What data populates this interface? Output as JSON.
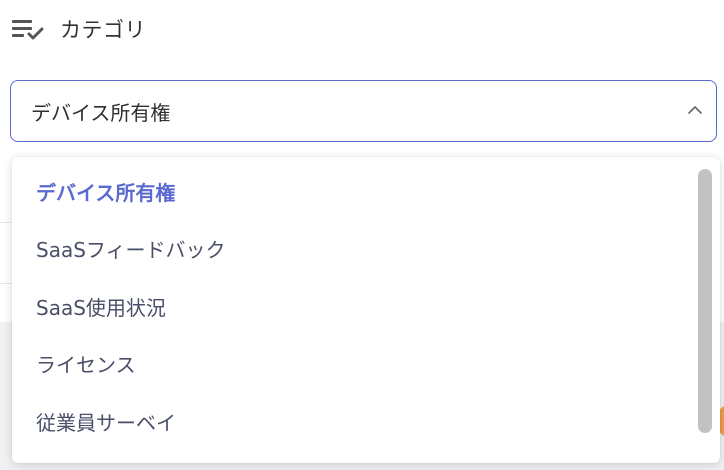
{
  "field": {
    "label": "カテゴリ",
    "label_icon": "list-check-icon"
  },
  "select": {
    "value": "デバイス所有権",
    "icon": "chevron-up-icon",
    "expanded": true
  },
  "dropdown": {
    "options": [
      {
        "label": "デバイス所有権",
        "selected": true
      },
      {
        "label": "SaaSフィードバック",
        "selected": false
      },
      {
        "label": "SaaS使用状況",
        "selected": false
      },
      {
        "label": "ライセンス",
        "selected": false
      },
      {
        "label": "従業員サーベイ",
        "selected": false
      }
    ]
  },
  "colors": {
    "accent": "#5b6ad0",
    "option_text": "#4a4f68",
    "label_text": "#333333",
    "scrollbar": "#c2c2c2"
  }
}
